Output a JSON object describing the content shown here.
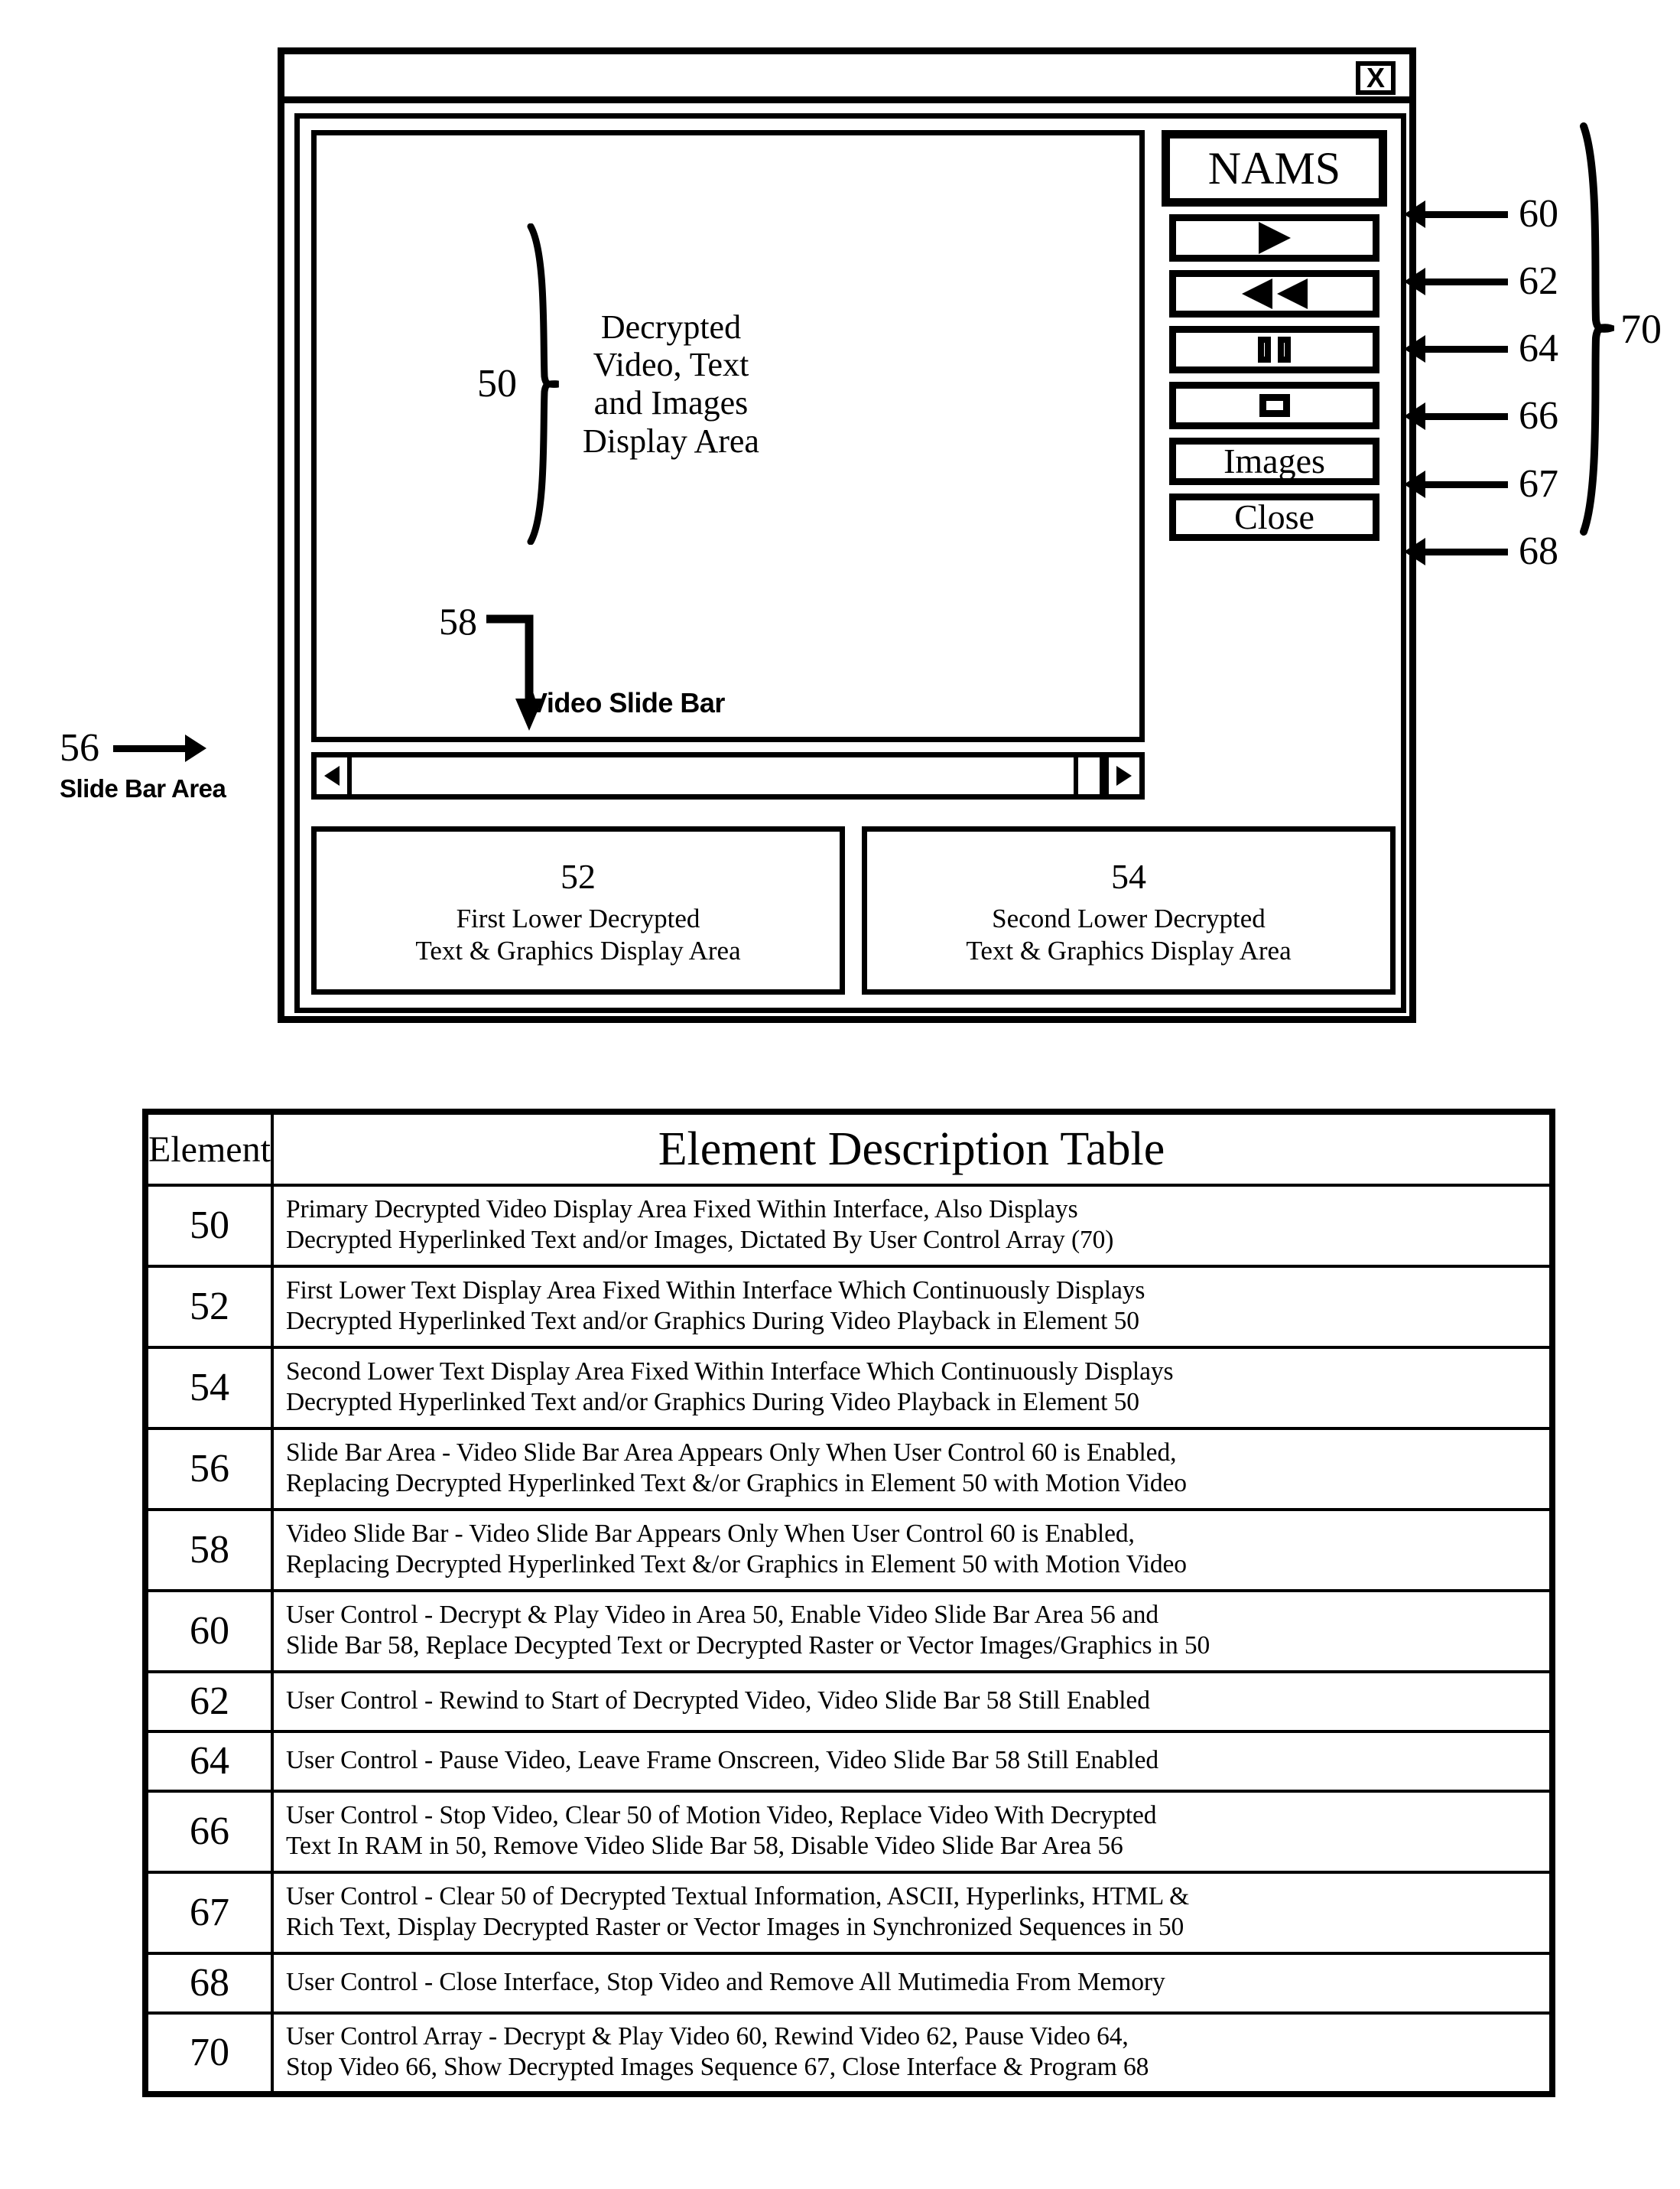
{
  "figure": {
    "window": {
      "close_button_label": "X",
      "brand_label": "NAMS"
    },
    "video_area": {
      "ref_number": "50",
      "caption": "Decrypted\nVideo, Text\nand Images\nDisplay Area"
    },
    "slide_bar_callout": {
      "ref_number": "58",
      "label": "Video Slide Bar",
      "left_arrow_icon": "triangle-left-icon",
      "right_arrow_icon": "triangle-right-icon"
    },
    "slide_bar_area_callout": {
      "ref_number": "56",
      "label": "Slide Bar Area"
    },
    "lower_areas": [
      {
        "ref_number": "52",
        "caption": "First Lower Decrypted\nText & Graphics Display Area"
      },
      {
        "ref_number": "54",
        "caption": "Second Lower Decrypted\nText & Graphics Display Area"
      }
    ],
    "controls": [
      {
        "ref_number": "60",
        "icon": "play-icon",
        "label": ""
      },
      {
        "ref_number": "62",
        "icon": "rewind-icon",
        "label": ""
      },
      {
        "ref_number": "64",
        "icon": "pause-icon",
        "label": ""
      },
      {
        "ref_number": "66",
        "icon": "stop-icon",
        "label": ""
      },
      {
        "ref_number": "67",
        "icon": "",
        "label": "Images"
      },
      {
        "ref_number": "68",
        "icon": "",
        "label": "Close"
      }
    ],
    "control_array_ref": "70"
  },
  "table": {
    "headers": [
      "Element",
      "Element Description Table"
    ],
    "rows": [
      {
        "element": "50",
        "lines": 2,
        "description": "Primary Decrypted Video Display Area Fixed Within Interface, Also Displays\nDecrypted Hyperlinked Text and/or Images, Dictated By User Control Array (70)"
      },
      {
        "element": "52",
        "lines": 2,
        "description": "First Lower Text Display Area Fixed Within Interface Which Continuously Displays\nDecrypted Hyperlinked Text and/or Graphics During Video Playback in Element 50"
      },
      {
        "element": "54",
        "lines": 2,
        "description": "Second Lower Text Display Area Fixed Within Interface Which Continuously Displays\nDecrypted Hyperlinked Text and/or Graphics During Video Playback in Element 50"
      },
      {
        "element": "56",
        "lines": 2,
        "description": "Slide Bar Area - Video Slide Bar Area Appears Only When User Control 60 is Enabled,\nReplacing Decrypted Hyperlinked Text &/or Graphics in Element 50 with Motion Video"
      },
      {
        "element": "58",
        "lines": 2,
        "description": "Video Slide Bar - Video Slide Bar Appears Only When User Control 60 is Enabled,\nReplacing Decrypted Hyperlinked Text &/or Graphics in Element 50 with Motion Video"
      },
      {
        "element": "60",
        "lines": 2,
        "description": "User Control - Decrypt & Play Video in Area 50, Enable Video Slide Bar Area 56 and\nSlide Bar 58, Replace Decypted Text or Decrypted Raster or Vector Images/Graphics in 50"
      },
      {
        "element": "62",
        "lines": 1,
        "description": "User Control - Rewind to Start of Decrypted Video, Video Slide Bar 58 Still Enabled"
      },
      {
        "element": "64",
        "lines": 1,
        "description": "User Control - Pause Video, Leave Frame Onscreen, Video Slide Bar 58 Still Enabled"
      },
      {
        "element": "66",
        "lines": 2,
        "description": "User Control - Stop Video, Clear 50 of Motion Video, Replace Video With Decrypted\nText In RAM in 50, Remove Video Slide Bar 58, Disable Video Slide Bar Area 56"
      },
      {
        "element": "67",
        "lines": 2,
        "description": "User Control - Clear 50 of Decrypted Textual Information, ASCII, Hyperlinks, HTML &\nRich Text, Display Decrypted Raster or Vector Images in Synchronized Sequences in 50"
      },
      {
        "element": "68",
        "lines": 1,
        "description": "User Control - Close Interface, Stop Video and Remove All Mutimedia From Memory"
      },
      {
        "element": "70",
        "lines": 2,
        "description": "User Control Array - Decrypt & Play Video 60, Rewind Video 62, Pause Video 64,\nStop Video 66, Show Decrypted Images Sequence 67, Close Interface & Program 68"
      }
    ]
  }
}
